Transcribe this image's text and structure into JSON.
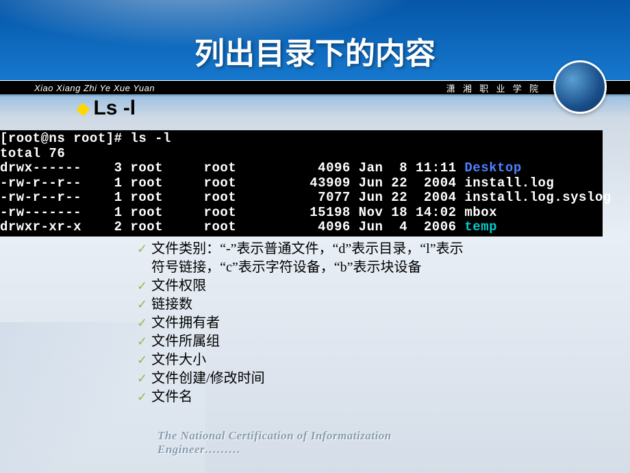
{
  "title": "列出目录下的内容",
  "band": {
    "left": "Xiao Xiang Zhi Ye Xue Yuan",
    "right": "潇 湘 职 业 学 院"
  },
  "subtitle": "Ls -l",
  "terminal": {
    "prompt": "[root@ns root]# ls -l",
    "total": "total 76",
    "rows": [
      {
        "perm": "drwx------",
        "links": "3",
        "owner": "root",
        "group": "root",
        "size": "4096",
        "date": "Jan  8 11:11",
        "name": "Desktop",
        "class": "blue"
      },
      {
        "perm": "-rw-r--r--",
        "links": "1",
        "owner": "root",
        "group": "root",
        "size": "43909",
        "date": "Jun 22  2004",
        "name": "install.log",
        "class": ""
      },
      {
        "perm": "-rw-r--r--",
        "links": "1",
        "owner": "root",
        "group": "root",
        "size": "7077",
        "date": "Jun 22  2004",
        "name": "install.log.syslog",
        "class": ""
      },
      {
        "perm": "-rw-------",
        "links": "1",
        "owner": "root",
        "group": "root",
        "size": "15198",
        "date": "Nov 18 14:02",
        "name": "mbox",
        "class": ""
      },
      {
        "perm": "drwxr-xr-x",
        "links": "2",
        "owner": "root",
        "group": "root",
        "size": "4096",
        "date": "Jun  4  2006",
        "name": "temp",
        "class": "cyan"
      }
    ]
  },
  "bullets": [
    "文件类别：“-”表示普通文件，“d”表示目录，“l”表示符号链接，“c”表示字符设备，“b”表示块设备",
    "文件权限",
    "链接数",
    "文件拥有者",
    "文件所属组",
    "文件大小",
    "文件创建/修改时间",
    "文件名"
  ],
  "footer": "The National Certification of Informatization Engineer………"
}
